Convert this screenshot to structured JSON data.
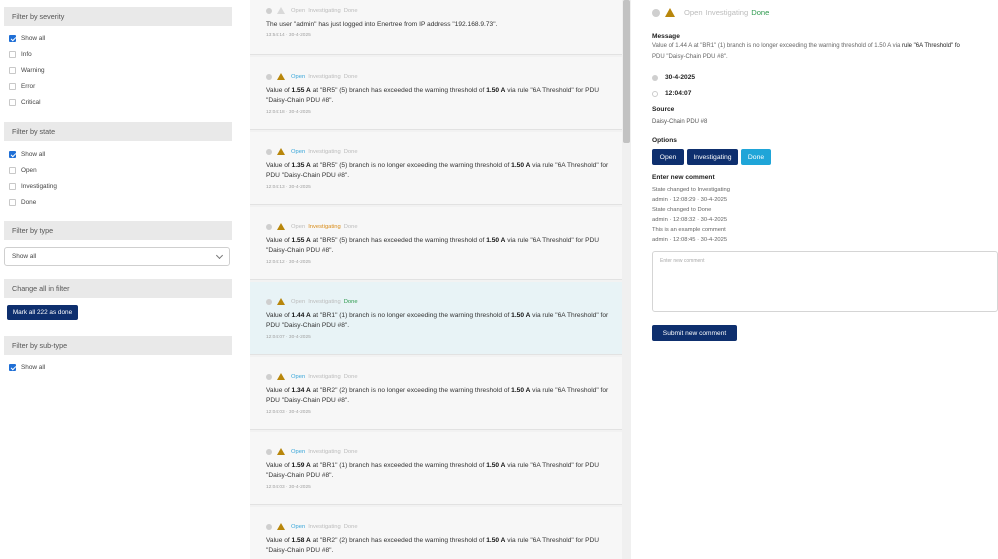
{
  "filters": {
    "severity": {
      "header": "Filter by severity",
      "items": [
        "Show all",
        "Info",
        "Warning",
        "Error",
        "Critical"
      ]
    },
    "state": {
      "header": "Filter by state",
      "items": [
        "Show all",
        "Open",
        "Investigating",
        "Done"
      ]
    },
    "type": {
      "header": "Filter by type",
      "selected": "Show all"
    },
    "change_all": {
      "header": "Change all in filter",
      "button": "Mark all 222 as done"
    },
    "subtype": {
      "header": "Filter by sub-type",
      "items": [
        "Show all"
      ]
    }
  },
  "events": [
    {
      "states": [
        "Open",
        "Investigating",
        "Done"
      ],
      "active": "",
      "icon": "none",
      "parts": [
        "The user \"admin\" has just logged into Enertree from IP address \"192.168.9.73\"."
      ],
      "meta": "13:54:14 · 30-4-2025"
    },
    {
      "states": [
        "Open",
        "Investigating",
        "Done"
      ],
      "active": "open",
      "icon": "warning",
      "pre": "Value of ",
      "val1": "1.55 A",
      "mid": " at \"BR5\" (5) branch has exceeded the warning threshold of ",
      "val2": "1.50 A",
      "post": " via rule \"6A Threshold\" for PDU \"Daisy-Chain PDU #8\".",
      "meta": "12:04:18 · 30-4-2025"
    },
    {
      "states": [
        "Open",
        "Investigating",
        "Done"
      ],
      "active": "open",
      "icon": "warning",
      "pre": "Value of ",
      "val1": "1.35 A",
      "mid": " at \"BR5\" (5) branch is no longer exceeding the warning threshold of ",
      "val2": "1.50 A",
      "post": " via rule \"6A Threshold\" for PDU \"Daisy-Chain PDU #8\".",
      "meta": "12:04:13 · 30-4-2025"
    },
    {
      "states": [
        "Open",
        "Investigating",
        "Done"
      ],
      "active": "inv",
      "icon": "warning",
      "pre": "Value of ",
      "val1": "1.55 A",
      "mid": " at \"BR5\" (5) branch has exceeded the warning threshold of ",
      "val2": "1.50 A",
      "post": " via rule \"6A Threshold\" for PDU \"Daisy-Chain PDU #8\".",
      "meta": "12:04:12 · 30-4-2025"
    },
    {
      "states": [
        "Open",
        "Investigating",
        "Done"
      ],
      "active": "done",
      "icon": "warning",
      "pre": "Value of ",
      "val1": "1.44 A",
      "mid": " at \"BR1\" (1) branch is no longer exceeding the warning threshold of ",
      "val2": "1.50 A",
      "post": " via rule \"6A Threshold\" for PDU \"Daisy-Chain PDU #8\".",
      "meta": "12:04:07 · 30-4-2025"
    },
    {
      "states": [
        "Open",
        "Investigating",
        "Done"
      ],
      "active": "open",
      "icon": "warning",
      "pre": "Value of ",
      "val1": "1.34 A",
      "mid": " at \"BR2\" (2) branch is no longer exceeding the warning threshold of ",
      "val2": "1.50 A",
      "post": " via rule \"6A Threshold\" for PDU \"Daisy-Chain PDU #8\".",
      "meta": "12:04:03 · 30-4-2025"
    },
    {
      "states": [
        "Open",
        "Investigating",
        "Done"
      ],
      "active": "open",
      "icon": "warning",
      "pre": "Value of ",
      "val1": "1.59 A",
      "mid": " at \"BR1\" (1) branch has exceeded the warning threshold of ",
      "val2": "1.50 A",
      "post": " via rule \"6A Threshold\" for PDU \"Daisy-Chain PDU #8\".",
      "meta": "12:04:03 · 30-4-2025"
    },
    {
      "states": [
        "Open",
        "Investigating",
        "Done"
      ],
      "active": "open",
      "icon": "warning",
      "pre": "Value of ",
      "val1": "1.58 A",
      "mid": " at \"BR2\" (2) branch has exceeded the warning threshold of ",
      "val2": "1.50 A",
      "post": " via rule \"6A Threshold\" for PDU \"Daisy-Chain PDU #8\".",
      "meta": ""
    }
  ],
  "detail": {
    "states": [
      "Open",
      "Investigating",
      "Done"
    ],
    "message_label": "Message",
    "message_pre": "Value of 1.44 A at \"BR1\" (1) branch is no longer exceeding the warning threshold of 1.50 A via ",
    "message_rule": "rule \"6A Threshold\" fo",
    "message_line2": "PDU \"Daisy-Chain PDU #8\".",
    "date": "30-4-2025",
    "time": "12:04:07",
    "source_label": "Source",
    "source": "Daisy-Chain PDU #8",
    "options_label": "Options",
    "options": [
      "Open",
      "Investigating",
      "Done"
    ],
    "comment_label": "Enter new comment",
    "comments": [
      "State changed to Investigating",
      "admin · 12:08:29 · 30-4-2025",
      "State changed to Done",
      "admin · 12:08:32 · 30-4-2025",
      "This is an example comment",
      "admin · 12:08:45 · 30-4-2025"
    ],
    "comment_placeholder": "Enter new comment",
    "submit": "Submit new comment"
  },
  "colors": {
    "primary": "#0e2f6e",
    "open": "#3aa6d9",
    "investigating": "#d98d1a",
    "done": "#2e9a4e",
    "done_btn": "#1fa5d8",
    "warning": "#b8860b"
  }
}
